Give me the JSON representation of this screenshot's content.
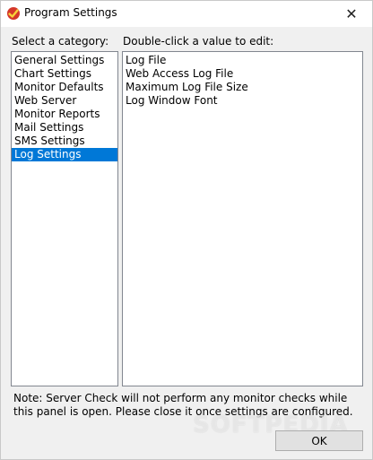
{
  "window": {
    "title": "Program Settings",
    "close_glyph": "✕"
  },
  "category_label": "Select a category:",
  "categories": {
    "items": [
      {
        "label": "General Settings",
        "selected": false
      },
      {
        "label": "Chart Settings",
        "selected": false
      },
      {
        "label": "Monitor Defaults",
        "selected": false
      },
      {
        "label": "Web Server",
        "selected": false
      },
      {
        "label": "Monitor Reports",
        "selected": false
      },
      {
        "label": "Mail Settings",
        "selected": false
      },
      {
        "label": "SMS Settings",
        "selected": false
      },
      {
        "label": "Log Settings",
        "selected": true
      }
    ]
  },
  "values_label": "Double-click a value to edit:",
  "values": {
    "items": [
      {
        "label": "Log File"
      },
      {
        "label": "Web Access Log File"
      },
      {
        "label": "Maximum Log File Size"
      },
      {
        "label": "Log Window Font"
      }
    ]
  },
  "note": "Note: Server Check will not perform any monitor checks while this panel is open. Please close it once settings are configured.",
  "ok_label": "OK",
  "watermark": "SOFTPEDIA",
  "colors": {
    "selection": "#0078d7",
    "dialog_bg": "#f0f0f0"
  }
}
